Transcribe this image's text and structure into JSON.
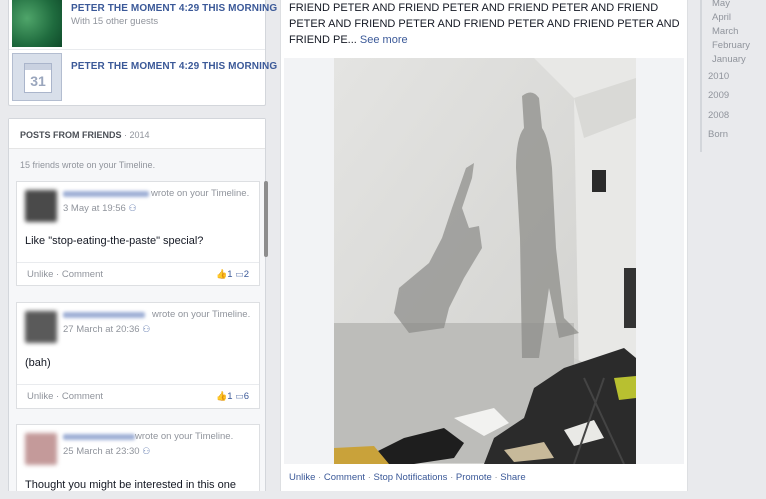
{
  "events": [
    {
      "title": "PETER THE MOMENT 4:29 THIS MORNING",
      "subtitle": "With 15 other guests"
    },
    {
      "title": "PETER THE MOMENT 4:29 THIS MORNING",
      "calendar_day": "31"
    }
  ],
  "posts_from_friends": {
    "title": "POSTS FROM FRIENDS",
    "year": "· 2014",
    "count_text": "15 friends wrote on your Timeline.",
    "posts": [
      {
        "head": "wrote on your Timeline.",
        "time": "3 May at 19:56",
        "body": "Like \"stop-eating-the-paste\" special?",
        "actions": "Unlike · Comment",
        "likes": "1",
        "comments": "2"
      },
      {
        "head": "wrote on your Timeline.",
        "time": "27 March at 20:36",
        "body": "(bah)",
        "actions": "Unlike · Comment",
        "likes": "1",
        "comments": "6"
      },
      {
        "head": "wrote on your Timeline.",
        "time": "25 March at 23:30",
        "body": "Thought you might be interested in this one"
      }
    ]
  },
  "main_post": {
    "caption": "FRIEND PETER AND FRIEND PETER AND FRIEND PETER AND FRIEND PETER AND FRIEND PETER AND FRIEND PETER AND FRIEND PETER AND FRIEND PE...",
    "see_more": "See more",
    "actions": {
      "unlike": "Unlike",
      "comment": "Comment",
      "stop": "Stop Notifications",
      "promote": "Promote",
      "share": "Share"
    }
  },
  "timeline": {
    "months": [
      "May",
      "April",
      "March",
      "February",
      "January"
    ],
    "years": [
      "2010",
      "2009",
      "2008",
      "Born"
    ]
  },
  "colors": {
    "link": "#3b5998",
    "muted": "#90949c",
    "background": "#e9eaed"
  }
}
